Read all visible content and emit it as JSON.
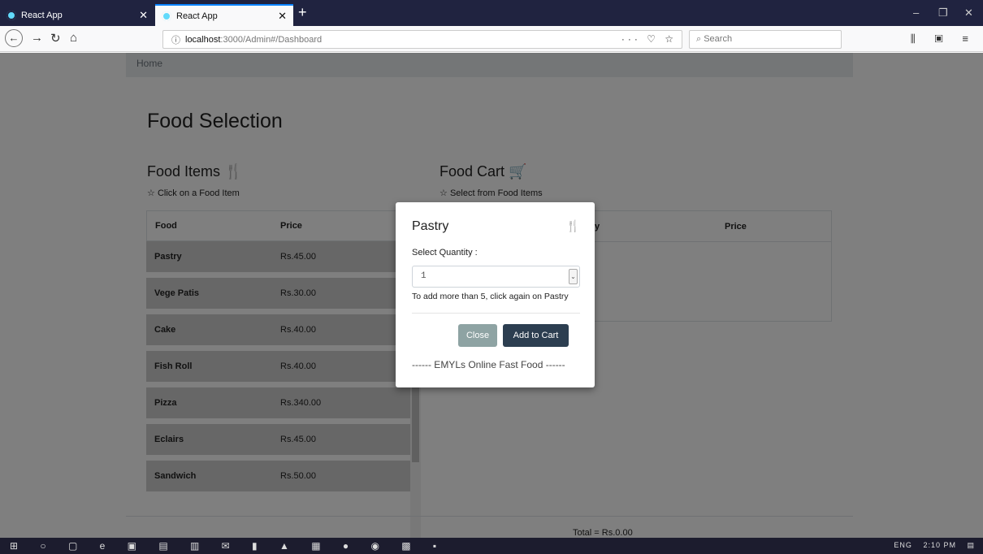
{
  "browser": {
    "tabs": [
      {
        "label": "React App",
        "active": false
      },
      {
        "label": "React App",
        "active": true
      }
    ],
    "new_tab": "+",
    "url": {
      "host": "localhost",
      "path": ":3000/Admin#/Dashboard"
    },
    "url_icons": "··· ♡ ☆",
    "search_placeholder": "Search",
    "toolbar_icons": "⫼ ▣ ≡",
    "window_controls": [
      "–",
      "❐",
      "✕"
    ]
  },
  "page": {
    "breadcrumb": "Home",
    "title": "Food Selection",
    "food_items": {
      "title": "Food Items",
      "icon": "utensils-icon",
      "subtitle": "Click on a Food Item",
      "headers": [
        "Food",
        "Price"
      ],
      "rows": [
        {
          "food": "Pastry",
          "price": "Rs.45.00"
        },
        {
          "food": "Vege Patis",
          "price": "Rs.30.00"
        },
        {
          "food": "Cake",
          "price": "Rs.40.00"
        },
        {
          "food": "Fish Roll",
          "price": "Rs.40.00"
        },
        {
          "food": "Pizza",
          "price": "Rs.340.00"
        },
        {
          "food": "Eclairs",
          "price": "Rs.45.00"
        },
        {
          "food": "Sandwich",
          "price": "Rs.50.00"
        }
      ]
    },
    "food_cart": {
      "title": "Food Cart",
      "icon": "cart-icon",
      "subtitle": "Select from Food Items",
      "headers": [
        "y",
        "Price"
      ]
    },
    "total": "Total = Rs.0.00"
  },
  "modal": {
    "title": "Pastry",
    "qty_label": "Select Quantity :",
    "qty_value": "1",
    "hint": "To add more than 5, click again on Pastry",
    "close_label": "Close",
    "add_label": "Add to Cart",
    "footer": "------ EMYLs Online Fast Food ------"
  },
  "taskbar": {
    "tray": "ENG",
    "time": "2:10 PM"
  }
}
